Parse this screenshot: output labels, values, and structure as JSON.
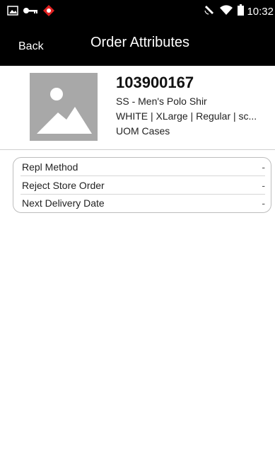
{
  "status_bar": {
    "time": "10:32",
    "left_icons": [
      "image-notification-icon",
      "key-icon",
      "alert-app-icon"
    ],
    "right_icons": [
      "rotation-icon",
      "wifi-icon",
      "battery-icon"
    ]
  },
  "header": {
    "back_label": "Back",
    "title": "Order Attributes",
    "background": "#000000"
  },
  "item": {
    "number": "103900167",
    "description": "SS - Men's Polo Shir",
    "attributes": "WHITE | XLarge | Regular | sc...",
    "uom": "UOM Cases"
  },
  "attributes": [
    {
      "label": "Repl Method",
      "value": "-"
    },
    {
      "label": "Reject Store Order",
      "value": "-"
    },
    {
      "label": "Next Delivery Date",
      "value": "-"
    }
  ]
}
